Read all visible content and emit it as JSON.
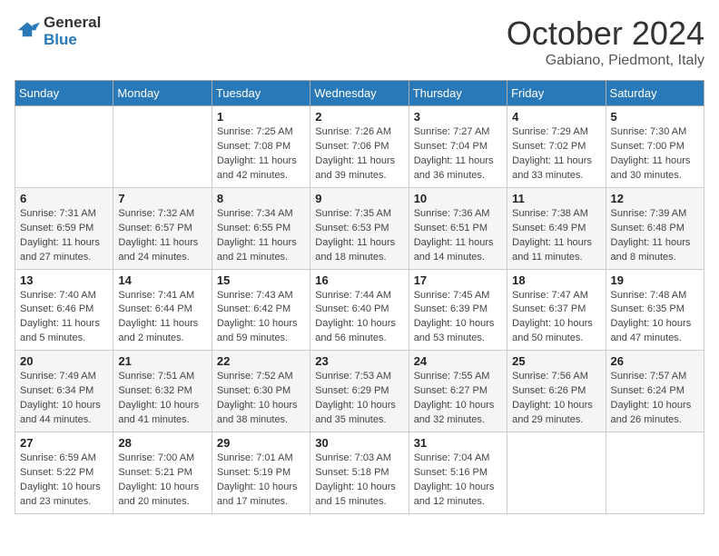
{
  "header": {
    "logo_line1": "General",
    "logo_line2": "Blue",
    "month": "October 2024",
    "location": "Gabiano, Piedmont, Italy"
  },
  "days_of_week": [
    "Sunday",
    "Monday",
    "Tuesday",
    "Wednesday",
    "Thursday",
    "Friday",
    "Saturday"
  ],
  "weeks": [
    [
      {
        "day": "",
        "info": ""
      },
      {
        "day": "",
        "info": ""
      },
      {
        "day": "1",
        "info": "Sunrise: 7:25 AM\nSunset: 7:08 PM\nDaylight: 11 hours and 42 minutes."
      },
      {
        "day": "2",
        "info": "Sunrise: 7:26 AM\nSunset: 7:06 PM\nDaylight: 11 hours and 39 minutes."
      },
      {
        "day": "3",
        "info": "Sunrise: 7:27 AM\nSunset: 7:04 PM\nDaylight: 11 hours and 36 minutes."
      },
      {
        "day": "4",
        "info": "Sunrise: 7:29 AM\nSunset: 7:02 PM\nDaylight: 11 hours and 33 minutes."
      },
      {
        "day": "5",
        "info": "Sunrise: 7:30 AM\nSunset: 7:00 PM\nDaylight: 11 hours and 30 minutes."
      }
    ],
    [
      {
        "day": "6",
        "info": "Sunrise: 7:31 AM\nSunset: 6:59 PM\nDaylight: 11 hours and 27 minutes."
      },
      {
        "day": "7",
        "info": "Sunrise: 7:32 AM\nSunset: 6:57 PM\nDaylight: 11 hours and 24 minutes."
      },
      {
        "day": "8",
        "info": "Sunrise: 7:34 AM\nSunset: 6:55 PM\nDaylight: 11 hours and 21 minutes."
      },
      {
        "day": "9",
        "info": "Sunrise: 7:35 AM\nSunset: 6:53 PM\nDaylight: 11 hours and 18 minutes."
      },
      {
        "day": "10",
        "info": "Sunrise: 7:36 AM\nSunset: 6:51 PM\nDaylight: 11 hours and 14 minutes."
      },
      {
        "day": "11",
        "info": "Sunrise: 7:38 AM\nSunset: 6:49 PM\nDaylight: 11 hours and 11 minutes."
      },
      {
        "day": "12",
        "info": "Sunrise: 7:39 AM\nSunset: 6:48 PM\nDaylight: 11 hours and 8 minutes."
      }
    ],
    [
      {
        "day": "13",
        "info": "Sunrise: 7:40 AM\nSunset: 6:46 PM\nDaylight: 11 hours and 5 minutes."
      },
      {
        "day": "14",
        "info": "Sunrise: 7:41 AM\nSunset: 6:44 PM\nDaylight: 11 hours and 2 minutes."
      },
      {
        "day": "15",
        "info": "Sunrise: 7:43 AM\nSunset: 6:42 PM\nDaylight: 10 hours and 59 minutes."
      },
      {
        "day": "16",
        "info": "Sunrise: 7:44 AM\nSunset: 6:40 PM\nDaylight: 10 hours and 56 minutes."
      },
      {
        "day": "17",
        "info": "Sunrise: 7:45 AM\nSunset: 6:39 PM\nDaylight: 10 hours and 53 minutes."
      },
      {
        "day": "18",
        "info": "Sunrise: 7:47 AM\nSunset: 6:37 PM\nDaylight: 10 hours and 50 minutes."
      },
      {
        "day": "19",
        "info": "Sunrise: 7:48 AM\nSunset: 6:35 PM\nDaylight: 10 hours and 47 minutes."
      }
    ],
    [
      {
        "day": "20",
        "info": "Sunrise: 7:49 AM\nSunset: 6:34 PM\nDaylight: 10 hours and 44 minutes."
      },
      {
        "day": "21",
        "info": "Sunrise: 7:51 AM\nSunset: 6:32 PM\nDaylight: 10 hours and 41 minutes."
      },
      {
        "day": "22",
        "info": "Sunrise: 7:52 AM\nSunset: 6:30 PM\nDaylight: 10 hours and 38 minutes."
      },
      {
        "day": "23",
        "info": "Sunrise: 7:53 AM\nSunset: 6:29 PM\nDaylight: 10 hours and 35 minutes."
      },
      {
        "day": "24",
        "info": "Sunrise: 7:55 AM\nSunset: 6:27 PM\nDaylight: 10 hours and 32 minutes."
      },
      {
        "day": "25",
        "info": "Sunrise: 7:56 AM\nSunset: 6:26 PM\nDaylight: 10 hours and 29 minutes."
      },
      {
        "day": "26",
        "info": "Sunrise: 7:57 AM\nSunset: 6:24 PM\nDaylight: 10 hours and 26 minutes."
      }
    ],
    [
      {
        "day": "27",
        "info": "Sunrise: 6:59 AM\nSunset: 5:22 PM\nDaylight: 10 hours and 23 minutes."
      },
      {
        "day": "28",
        "info": "Sunrise: 7:00 AM\nSunset: 5:21 PM\nDaylight: 10 hours and 20 minutes."
      },
      {
        "day": "29",
        "info": "Sunrise: 7:01 AM\nSunset: 5:19 PM\nDaylight: 10 hours and 17 minutes."
      },
      {
        "day": "30",
        "info": "Sunrise: 7:03 AM\nSunset: 5:18 PM\nDaylight: 10 hours and 15 minutes."
      },
      {
        "day": "31",
        "info": "Sunrise: 7:04 AM\nSunset: 5:16 PM\nDaylight: 10 hours and 12 minutes."
      },
      {
        "day": "",
        "info": ""
      },
      {
        "day": "",
        "info": ""
      }
    ]
  ]
}
